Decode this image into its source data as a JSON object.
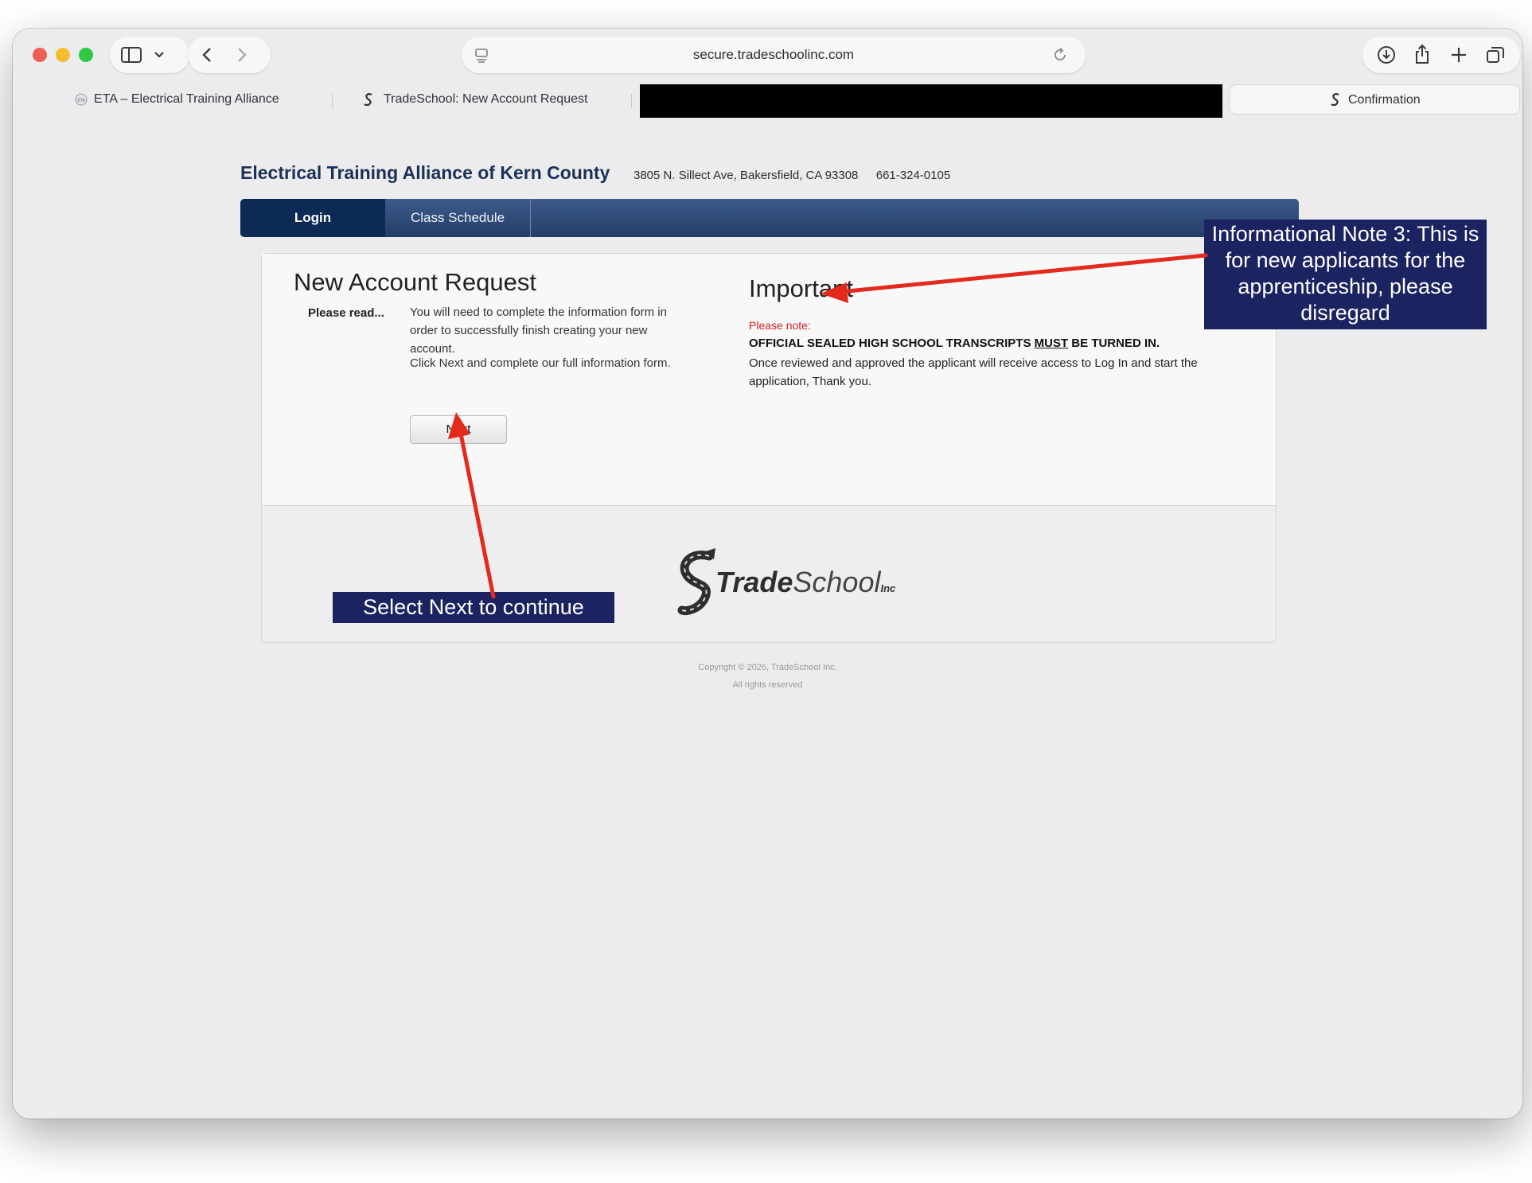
{
  "browser": {
    "url": "secure.tradeschoolinc.com",
    "tabs": [
      {
        "label": "ETA – Electrical Training Alliance"
      },
      {
        "label": "TradeSchool: New Account Request"
      },
      {
        "label": ""
      },
      {
        "label": "Confirmation"
      }
    ]
  },
  "site": {
    "title": "Electrical Training Alliance of Kern County",
    "address": "3805 N. Sillect Ave, Bakersfield, CA 93308",
    "phone": "661-324-0105",
    "nav": {
      "login": "Login",
      "schedule": "Class Schedule"
    }
  },
  "new_account": {
    "heading": "New Account Request",
    "please_read": "Please read...",
    "para1": "You will need to complete the information form in order to successfully finish creating your new account.",
    "para2": "Click Next and complete our full information form.",
    "next_label": "Next"
  },
  "important": {
    "heading": "Important",
    "please_note": "Please note:",
    "official_pre": "OFFICIAL SEALED HIGH SCHOOL TRANSCRIPTS ",
    "official_must": "MUST",
    "official_post": " BE TURNED IN.",
    "once": "Once reviewed and approved the applicant will receive access to Log In and start the application, Thank you."
  },
  "logo": {
    "main": "Trade",
    "light": "School",
    "inc": "Inc"
  },
  "footer": {
    "copyright": "Copyright © 2026, TradeSchool Inc.",
    "rights": "All rights reserved"
  },
  "annotations": {
    "next_callout": "Select Next to continue",
    "info_callout": "Informational Note 3: This is for new applicants for the apprenticeship, please disregard"
  },
  "colors": {
    "nav_bar": "#233e6a",
    "title": "#1b3056",
    "callout": "#1c2361",
    "arrow": "#e42a1d",
    "note_red": "#d21f1f"
  }
}
